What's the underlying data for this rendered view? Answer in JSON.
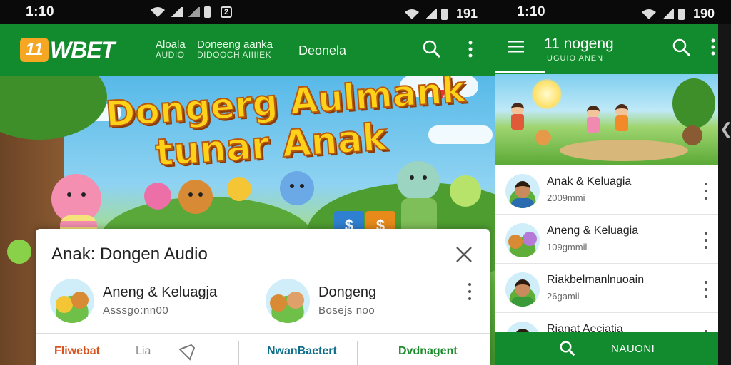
{
  "status_left": {
    "time": "1:10",
    "right_text": "191",
    "notif_badge": "2"
  },
  "status_right": {
    "time": "1:10",
    "right_text": "190"
  },
  "app_left": {
    "logo_number": "11",
    "logo_text": "WBET",
    "nav": [
      {
        "main": "Aloala",
        "sub": "AUDIO"
      },
      {
        "main": "Doneeng aanka",
        "sub": "DIDOOCH AIIIIEK"
      },
      {
        "main": "Deonela",
        "sub": ""
      }
    ],
    "hero_title_line1": "Dongerg Aulmank",
    "hero_title_line2": "tunar Anak",
    "hero_block_symbol": "$",
    "dialog": {
      "title": "Anak: Dongen Audio",
      "items": [
        {
          "title": "Aneng & Keluagja",
          "subtitle": "Asssgo:nn00"
        },
        {
          "title": "Dongeng",
          "subtitle": "Bosejs noo"
        }
      ],
      "actions": [
        "Fliwebat",
        "Lia",
        "NwanBaetert",
        "Dvdnagent"
      ]
    }
  },
  "app_right": {
    "title": "11 nogeng",
    "subtitle": "UGUIO ANEN",
    "list": [
      {
        "title": "Anak & Keluagia",
        "subtitle": "2009mmi"
      },
      {
        "title": "Aneng & Keluagia",
        "subtitle": "109gmmil"
      },
      {
        "title": "Riakbelmanlnuoain",
        "subtitle": "26gamil"
      },
      {
        "title": "Rianat Aeciatia",
        "subtitle": ""
      }
    ],
    "bottom_label": "NAUONI"
  },
  "colors": {
    "brand_green": "#128a2e",
    "logo_orange": "#f5a623",
    "title_yellow": "#ffd21a",
    "action_orange": "#d9531e",
    "action_teal": "#0f6f8a",
    "action_green": "#1a8a2a"
  },
  "icons": [
    "wifi-icon",
    "signal-icon",
    "battery-icon",
    "search-icon",
    "more-vert-icon",
    "close-icon",
    "menu-icon",
    "pin-icon",
    "chevron-left-icon"
  ]
}
